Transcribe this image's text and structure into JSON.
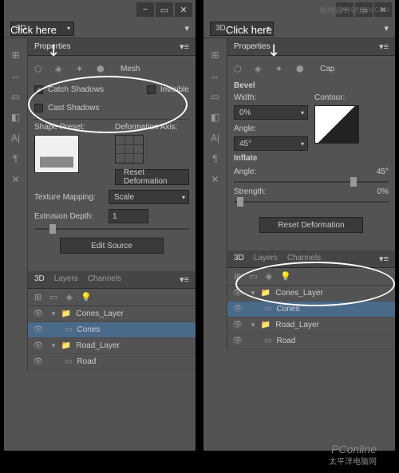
{
  "mode_dropdown": "3D",
  "properties_tab": "Properties",
  "annotations": {
    "click_here": "Click here"
  },
  "left": {
    "mesh_label": "Mesh",
    "catch_shadows": "Catch Shadows",
    "cast_shadows": "Cast Shadows",
    "invisible": "Invisible",
    "shape_preset": "Shape Preset:",
    "deformation_axis": "Deformation Axis:",
    "reset_deformation": "Reset Deformation",
    "texture_mapping": "Texture Mapping:",
    "texture_mapping_value": "Scale",
    "extrusion_depth": "Extrusion Depth:",
    "extrusion_depth_value": "1",
    "edit_source": "Edit Source"
  },
  "right": {
    "cap_label": "Cap",
    "bevel_title": "Bevel",
    "width_label": "Width:",
    "width_value": "0%",
    "contour_label": "Contour:",
    "angle_label": "Angle:",
    "angle_value": "45°",
    "inflate_title": "Inflate",
    "inflate_angle_label": "Angle:",
    "inflate_angle_value": "45°",
    "strength_label": "Strength:",
    "strength_value": "0%",
    "reset_deformation": "Reset Deformation"
  },
  "layers": {
    "tabs": [
      "3D",
      "Layers",
      "Channels"
    ],
    "items": [
      {
        "name": "Cones_Layer",
        "type": "folder"
      },
      {
        "name": "Cones",
        "type": "layer",
        "selected": true
      },
      {
        "name": "Road_Layer",
        "type": "folder"
      },
      {
        "name": "Road",
        "type": "layer"
      }
    ]
  },
  "watermarks": {
    "top": "思缘设计论坛",
    "url": "WWW.MISSYUAN.COM",
    "bottom1": "PConline",
    "bottom2": "太平洋电脑网"
  }
}
